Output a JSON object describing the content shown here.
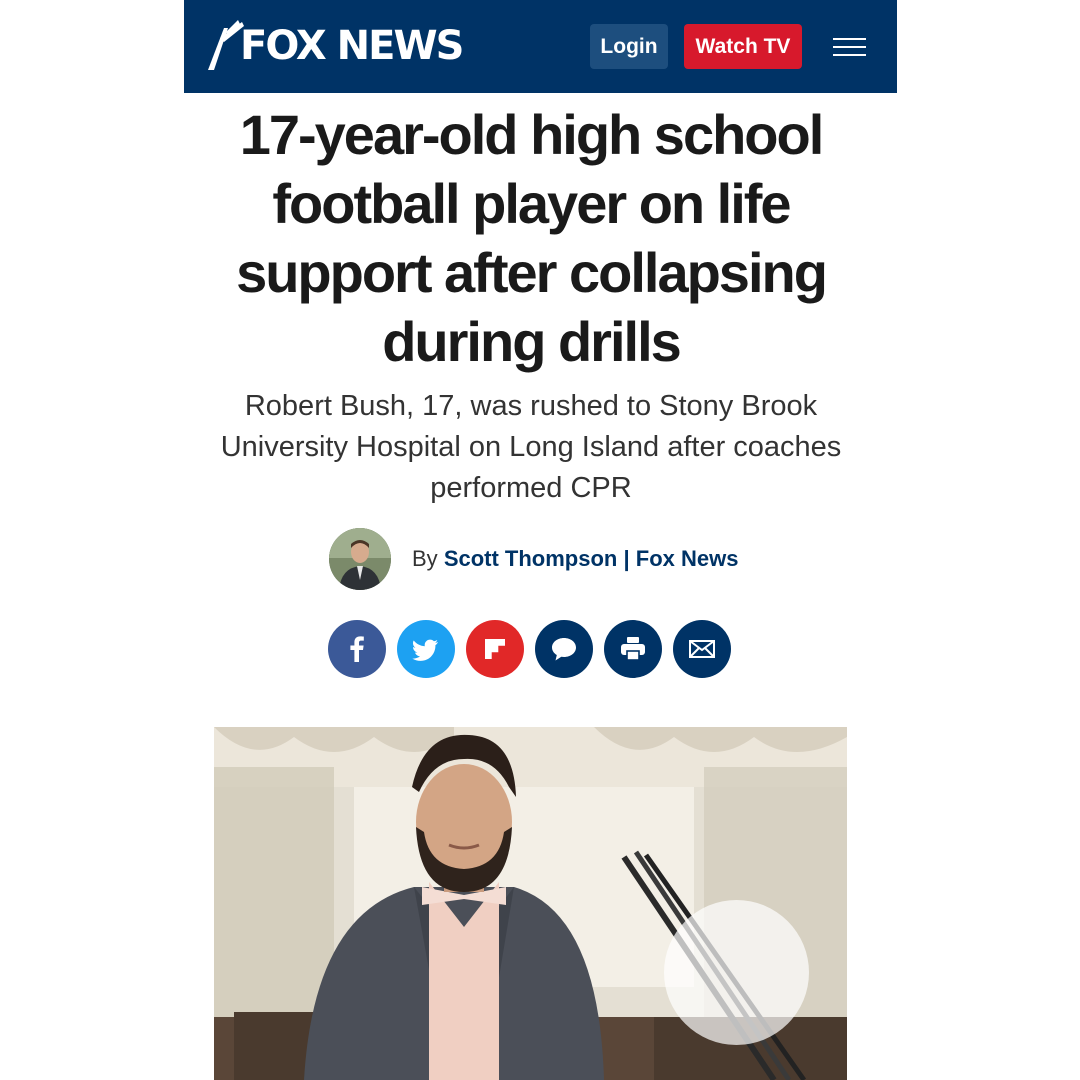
{
  "header": {
    "logo_text": "FOX NEWS",
    "login_label": "Login",
    "watch_label": "Watch TV",
    "colors": {
      "bar": "#003366",
      "login": "#1d4e7e",
      "watch": "#d7192c"
    }
  },
  "article": {
    "headline": "17-year-old high school football player on life support after collapsing during drills",
    "dek": "Robert Bush, 17, was rushed to Stony Brook University Hospital on Long Island after coaches performed CPR",
    "byline": {
      "prefix": "By",
      "author": "Scott Thompson",
      "separator": "|",
      "outlet": "Fox News"
    }
  },
  "share": [
    {
      "name": "facebook-icon",
      "color": "#3b5998"
    },
    {
      "name": "twitter-icon",
      "color": "#1da1f2"
    },
    {
      "name": "flipboard-icon",
      "color": "#e12828"
    },
    {
      "name": "comment-icon",
      "color": "#003366"
    },
    {
      "name": "print-icon",
      "color": "#003366"
    },
    {
      "name": "email-icon",
      "color": "#003366"
    }
  ]
}
